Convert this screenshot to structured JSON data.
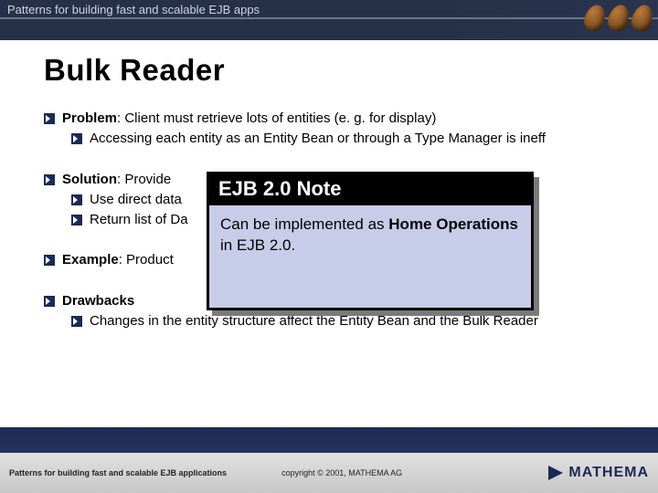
{
  "header": {
    "subtitle": "Patterns for building fast and scalable EJB apps"
  },
  "title": "Bulk Reader",
  "sections": {
    "problem": {
      "label": "Problem",
      "text": ": Client must retrieve lots of entities (e. g. for display)",
      "subs": [
        "Accessing each entity as an Entity Bean or through a Type Manager is ineff"
      ]
    },
    "solution": {
      "label": "Solution",
      "text": ": Provide",
      "subs": [
        "Use direct data",
        "Return list of Da"
      ]
    },
    "example": {
      "label": "Example",
      "text": ": Product"
    },
    "drawbacks": {
      "label": "Drawbacks",
      "subs": [
        "Changes in the entity structure affect the Entity Bean and the Bulk Reader"
      ]
    }
  },
  "note": {
    "title": "EJB 2.0 Note",
    "body_pre": "Can be implemented as ",
    "body_bold": "Home Operations",
    "body_post": " in EJB 2.0."
  },
  "footer": {
    "left": "Patterns for building fast and scalable EJB applications",
    "copyright": "copyright © 2001, MATHEMA AG",
    "logo_text": "MATHEMA"
  }
}
